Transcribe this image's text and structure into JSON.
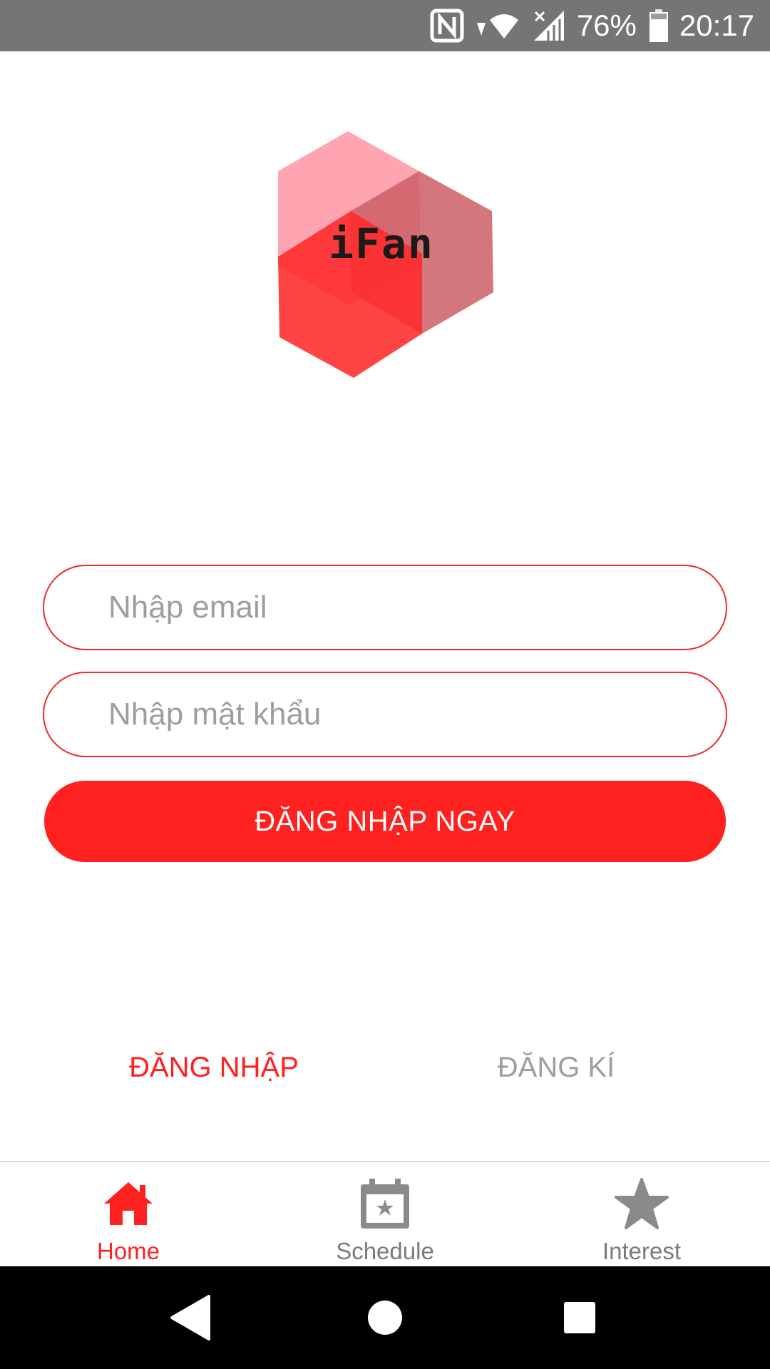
{
  "status_bar": {
    "battery_percent": "76%",
    "time": "20:17",
    "icons": [
      "nfc-icon",
      "wifi-icon",
      "signal-icon",
      "battery-icon"
    ]
  },
  "logo": {
    "text": "iFan"
  },
  "form": {
    "email_placeholder": "Nhập email",
    "password_placeholder": "Nhập mật khẩu",
    "submit_label": "ĐĂNG NHẬP NGAY"
  },
  "auth_tabs": {
    "login_label": "ĐĂNG NHẬP",
    "register_label": "ĐĂNG KÍ",
    "active": "login"
  },
  "bottom_nav": {
    "items": [
      {
        "label": "Home",
        "icon": "home-icon",
        "active": true
      },
      {
        "label": "Schedule",
        "icon": "calendar-star-icon",
        "active": false
      },
      {
        "label": "Interest",
        "icon": "star-icon",
        "active": false
      }
    ]
  },
  "colors": {
    "accent": "#ff2020",
    "status_bar": "#757575",
    "inactive": "#9e9e9e"
  }
}
